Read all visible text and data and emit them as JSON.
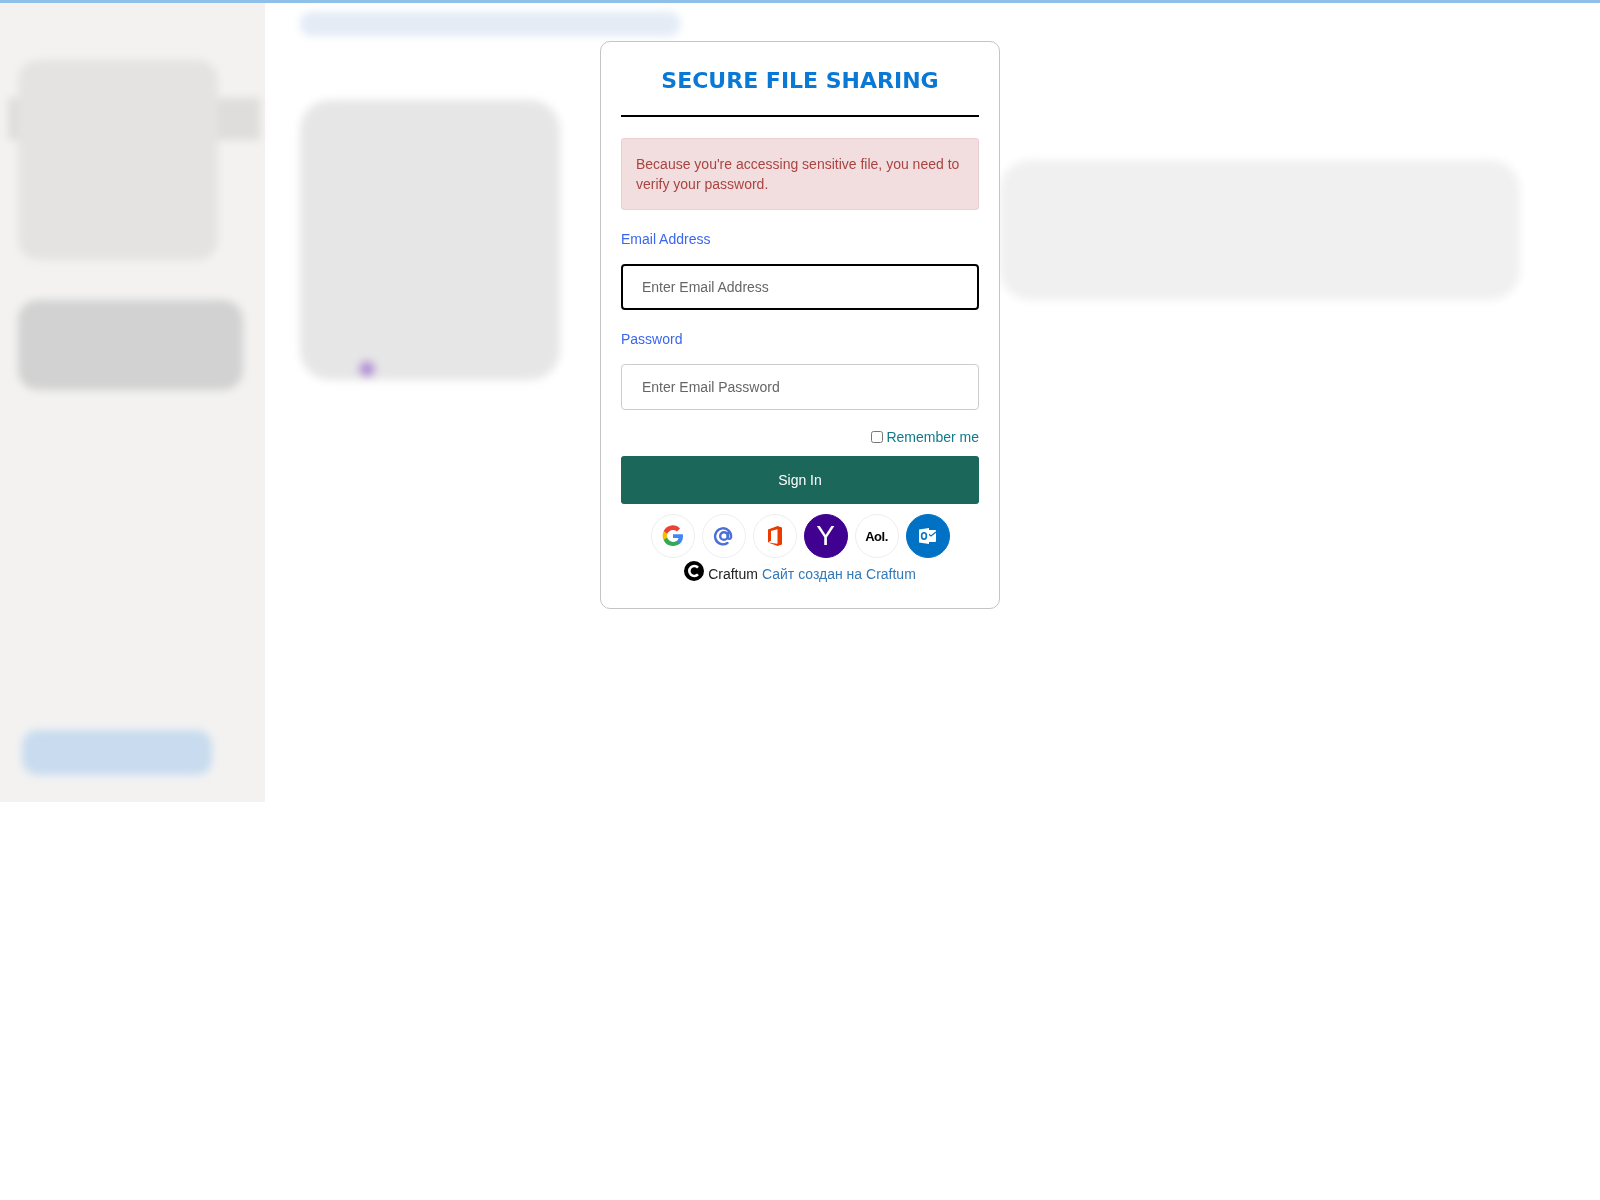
{
  "dialog": {
    "title": "SECURE FILE SHARING",
    "alert": "Because you're accessing sensitive file, you need to verify your password.",
    "fields": [
      {
        "label": "Email Address",
        "placeholder": "Enter Email Address",
        "focused": true
      },
      {
        "label": "Password",
        "placeholder": "Enter Email Password",
        "focused": false
      }
    ],
    "remember": {
      "label": "Remember me",
      "checked": false
    },
    "submit": "Sign In",
    "providers": [
      {
        "kind": "google"
      },
      {
        "kind": "email"
      },
      {
        "kind": "office"
      },
      {
        "kind": "yahoo",
        "label": "Y"
      },
      {
        "kind": "aol",
        "label": "Aol."
      },
      {
        "kind": "outlook"
      }
    ],
    "footer": {
      "brand": "Craftum",
      "link": "Сайт создан на Craftum"
    }
  }
}
